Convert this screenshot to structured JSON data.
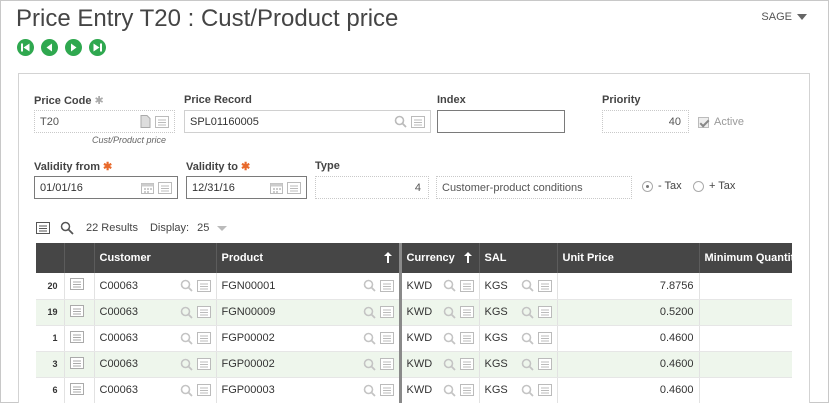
{
  "header": {
    "title": "Price Entry T20 : Cust/Product price",
    "user_menu": "SAGE"
  },
  "nav": {
    "buttons": [
      "first-record",
      "previous-record",
      "next-record",
      "last-record"
    ]
  },
  "form": {
    "price_code": {
      "label": "Price Code",
      "value": "T20",
      "subtitle": "Cust/Product price"
    },
    "price_record": {
      "label": "Price Record",
      "value": "SPL01160005"
    },
    "index": {
      "label": "Index",
      "value": ""
    },
    "priority": {
      "label": "Priority",
      "value": "40"
    },
    "active": {
      "label": "Active",
      "checked": true
    },
    "validity_from": {
      "label": "Validity from",
      "value": "01/01/16"
    },
    "validity_to": {
      "label": "Validity to",
      "value": "12/31/16"
    },
    "type": {
      "label": "Type",
      "value": "4",
      "description": "Customer-product conditions"
    },
    "tax_options": [
      {
        "label": "- Tax",
        "selected": true
      },
      {
        "label": "+ Tax",
        "selected": false
      }
    ]
  },
  "grid": {
    "results_text": "22 Results",
    "display_label": "Display:",
    "display_value": "25",
    "columns": [
      "Customer",
      "Product",
      "Currency",
      "SAL",
      "Unit Price",
      "Minimum Quantity"
    ],
    "rows": [
      {
        "line": "20",
        "customer": "C00063",
        "product": "FGN00001",
        "currency": "KWD",
        "sal": "KGS",
        "unit_price": "7.8756",
        "min_qty": ""
      },
      {
        "line": "19",
        "customer": "C00063",
        "product": "FGN00009",
        "currency": "KWD",
        "sal": "KGS",
        "unit_price": "0.5200",
        "min_qty": ""
      },
      {
        "line": "1",
        "customer": "C00063",
        "product": "FGP00002",
        "currency": "KWD",
        "sal": "KGS",
        "unit_price": "0.4600",
        "min_qty": ""
      },
      {
        "line": "3",
        "customer": "C00063",
        "product": "FGP00002",
        "currency": "KWD",
        "sal": "KGS",
        "unit_price": "0.4600",
        "min_qty": ""
      },
      {
        "line": "6",
        "customer": "C00063",
        "product": "FGP00003",
        "currency": "KWD",
        "sal": "KGS",
        "unit_price": "0.4600",
        "min_qty": ""
      }
    ]
  },
  "colors": {
    "accent_green": "#2fa84f",
    "grid_header": "#464646",
    "row_alt": "#eef6ec",
    "required": "#e8692b"
  }
}
